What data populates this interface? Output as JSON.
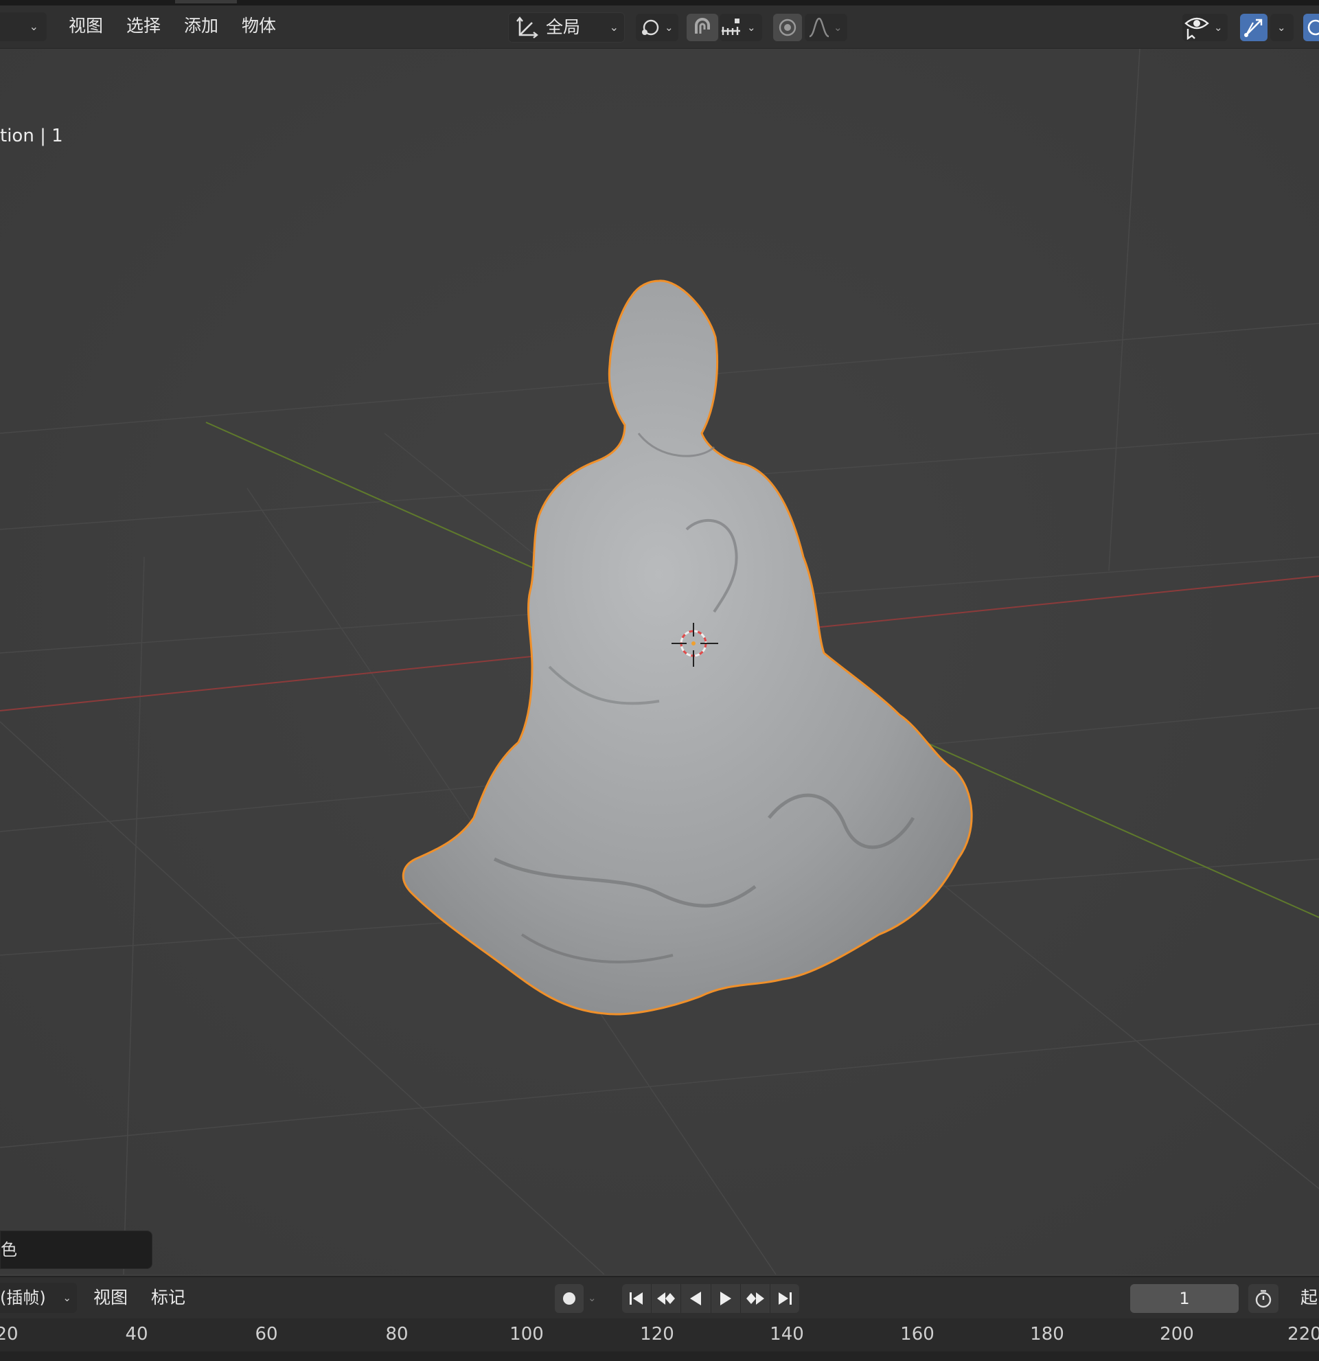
{
  "header": {
    "menus": {
      "view": "视图",
      "select": "选择",
      "add": "添加",
      "object": "物体"
    },
    "transform_orientation": "全局",
    "icons": {
      "orientation": "transform-orientation-icon",
      "pivot": "pivot-point-icon",
      "snap": "snap-magnet-icon",
      "snap_increment": "snap-increment-icon",
      "proportional": "proportional-editing-icon",
      "falloff": "falloff-curve-icon",
      "visibility": "visibility-eye-icon",
      "gizmo": "gizmo-icon"
    },
    "colors": {
      "active_button": "#4772b3"
    }
  },
  "viewport": {
    "overlay_text": "tion | 1",
    "selection_outline_color": "#f0902a"
  },
  "attribute_panel": {
    "text": "色"
  },
  "timeline": {
    "menus": {
      "keying": "(插帧)",
      "view": "视图",
      "marker": "标记"
    },
    "current_frame": "1",
    "start_label": "起",
    "ruler_ticks": [
      "20",
      "40",
      "60",
      "80",
      "100",
      "120",
      "140",
      "160",
      "180",
      "200",
      "220"
    ]
  }
}
